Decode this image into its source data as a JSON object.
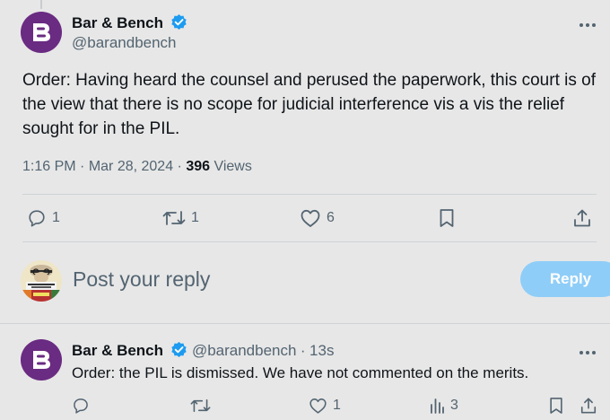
{
  "main_tweet": {
    "author_name": "Bar & Bench",
    "author_handle": "@barandbench",
    "text": "Order: Having heard the counsel and perused the paperwork, this court is of the view that there is no scope for judicial interference vis a vis the relief sought for in the PIL.",
    "time": "1:16 PM",
    "date": "Mar 28, 2024",
    "views_count": "396",
    "views_label": "Views",
    "replies": "1",
    "reposts": "1",
    "likes": "6"
  },
  "composer": {
    "placeholder": "Post your reply",
    "reply_button": "Reply"
  },
  "reply_tweet": {
    "author_name": "Bar & Bench",
    "author_handle": "@barandbench",
    "age": "13s",
    "text": "Order: the PIL is dismissed. We have not commented on the merits.",
    "likes": "1",
    "views": "3"
  },
  "colors": {
    "brand_avatar": "#6a2b82",
    "verified_badge": "#1d9bf0",
    "reply_button": "#8ecdf8",
    "secondary_text": "#536471"
  },
  "icons": {
    "more": "more-dots-icon",
    "reply": "reply-icon",
    "repost": "repost-icon",
    "like": "like-icon",
    "bookmark": "bookmark-icon",
    "share": "share-icon",
    "views": "views-icon"
  }
}
